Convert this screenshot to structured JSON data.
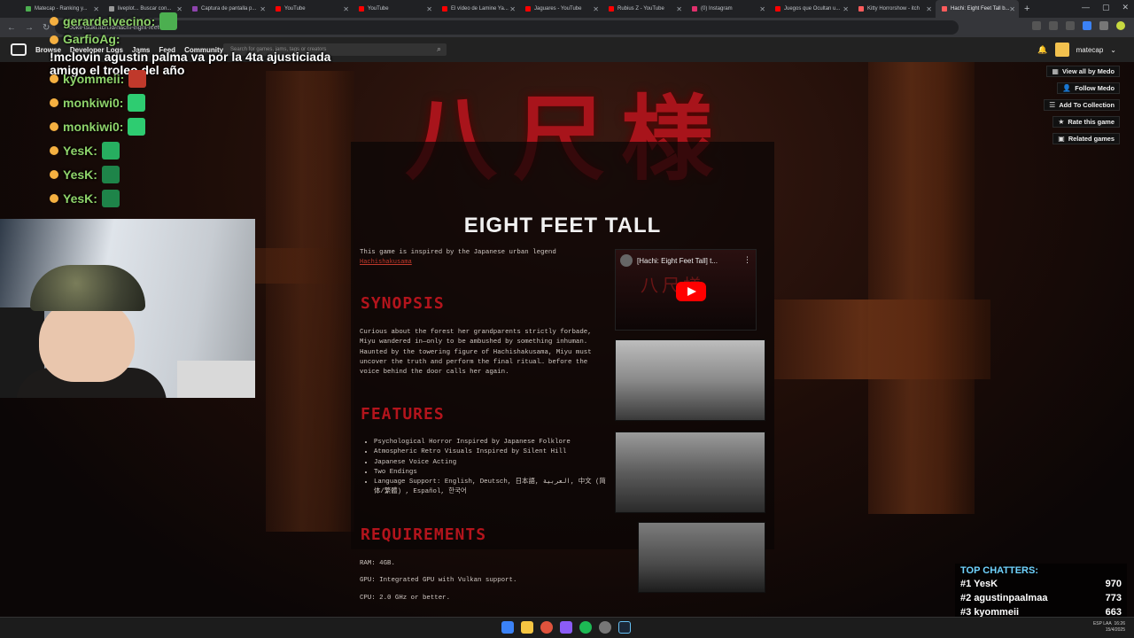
{
  "browser": {
    "tabs": [
      {
        "label": "Matecap - Ranking y...",
        "color": "#4caf50"
      },
      {
        "label": "liveplot... Buscar con...",
        "color": "#999"
      },
      {
        "label": "Captura de pantalla p...",
        "color": "#8e44ad"
      },
      {
        "label": "YouTube",
        "color": "#ff0000"
      },
      {
        "label": "YouTube",
        "color": "#ff0000"
      },
      {
        "label": "El vídeo de Lamine Ya...",
        "color": "#ff0000"
      },
      {
        "label": "Jaguares - YouTube",
        "color": "#ff0000"
      },
      {
        "label": "Rubius Z - YouTube",
        "color": "#ff0000"
      },
      {
        "label": "(0) Instagram",
        "color": "#e1306c"
      },
      {
        "label": "Juegos que Ocultan u...",
        "color": "#ff0000"
      },
      {
        "label": "Kitty Horrorshow - itch",
        "color": "#ff5c5c"
      },
      {
        "label": "Hachi: Eight Feet Tall b...",
        "color": "#ff5c5c"
      }
    ],
    "active_tab": 11,
    "url": "ookii-tsuki.itch.io/hachi-eight-feet-tall"
  },
  "itch": {
    "menu": [
      "Browse",
      "Developer Logs",
      "Jams",
      "Feed",
      "Community"
    ],
    "search_placeholder": "Search for games, jams, tags or creators",
    "username": "matecap",
    "side_buttons": [
      {
        "label": "View all by Medo",
        "icon": "grid-icon"
      },
      {
        "label": "Follow Medo",
        "icon": "follow-icon"
      },
      {
        "label": "Add To Collection",
        "icon": "list-icon"
      },
      {
        "label": "Rate this game",
        "icon": "star-icon"
      },
      {
        "label": "Related games",
        "icon": "related-icon"
      }
    ]
  },
  "game": {
    "kanji": "八尺様",
    "title": "EIGHT FEET TALL",
    "intro": "This game is inspired by the Japanese urban legend",
    "intro_link": "Hachishakusama",
    "synopsis_heading": "SYNOPSIS",
    "synopsis": "Curious about the forest her grandparents strictly forbade, Miyu wandered in—only to be ambushed by something inhuman. Haunted by the towering figure of Hachishakusama, Miyu must uncover the truth and perform the final ritual… before the voice behind the door calls her again.",
    "features_heading": "FEATURES",
    "features": [
      "Psychological Horror Inspired by Japanese Folklore",
      "Atmospheric Retro Visuals Inspired by Silent Hill",
      "Japanese Voice Acting",
      "Two Endings",
      "Language Support: English, Deutsch, 日本語, العربية, 中文 (简体/繁體) , Español, 한국어"
    ],
    "requirements_heading": "REQUIREMENTS",
    "requirements": [
      "RAM: 4GB.",
      "GPU: Integrated GPU with Vulkan support.",
      "CPU: 2.0 GHz or better."
    ],
    "video_title": "[Hachi: Eight Feet Tall] t..."
  },
  "stream": {
    "chat": [
      {
        "name": "gerardelvecino:",
        "msg": ""
      },
      {
        "name": "GarfioAg:",
        "msg": "!mclovin agustin palma va por la 4ta ajusticiada amigo el troleo del año"
      },
      {
        "name": "kyommeii:",
        "msg": ""
      },
      {
        "name": "monkiwi0:",
        "msg": ""
      },
      {
        "name": "monkiwi0:",
        "msg": ""
      },
      {
        "name": "YesK:",
        "msg": ""
      },
      {
        "name": "YesK:",
        "msg": ""
      },
      {
        "name": "YesK:",
        "msg": ""
      }
    ],
    "top_title": "TOP CHATTERS:",
    "top": [
      {
        "rank": "#1",
        "name": "YesK",
        "score": "970"
      },
      {
        "rank": "#2",
        "name": "agustinpaalmaa",
        "score": "773"
      },
      {
        "rank": "#3",
        "name": "kyommeii",
        "score": "663"
      }
    ]
  },
  "taskbar": {
    "lang": "ESP LAA",
    "time": "16:26",
    "date": "15/4/2025"
  }
}
